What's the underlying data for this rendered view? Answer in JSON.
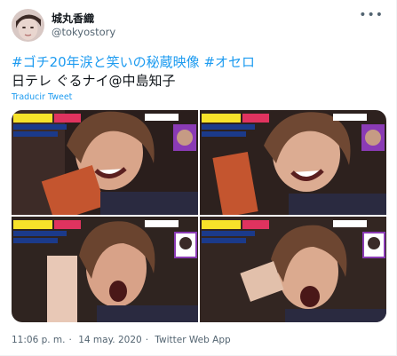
{
  "author": {
    "display_name": "城丸香織",
    "handle": "@tokyostory"
  },
  "tweet": {
    "hashtag_1": "#ゴチ20年涙と笑いの秘蔵映像",
    "hashtag_2": "#オセロ",
    "line2": "日テレ ぐるナイ@中島知子",
    "translate_label": "Traducir Tweet"
  },
  "media": {
    "count": 4,
    "description_icon": "video-still-photo"
  },
  "meta": {
    "time": "11:06 p. m.",
    "separator": "·",
    "date": "14 may. 2020",
    "source": "Twitter Web App"
  },
  "colors": {
    "link": "#1d9bf0",
    "text": "#0f1419",
    "muted": "#536471"
  }
}
